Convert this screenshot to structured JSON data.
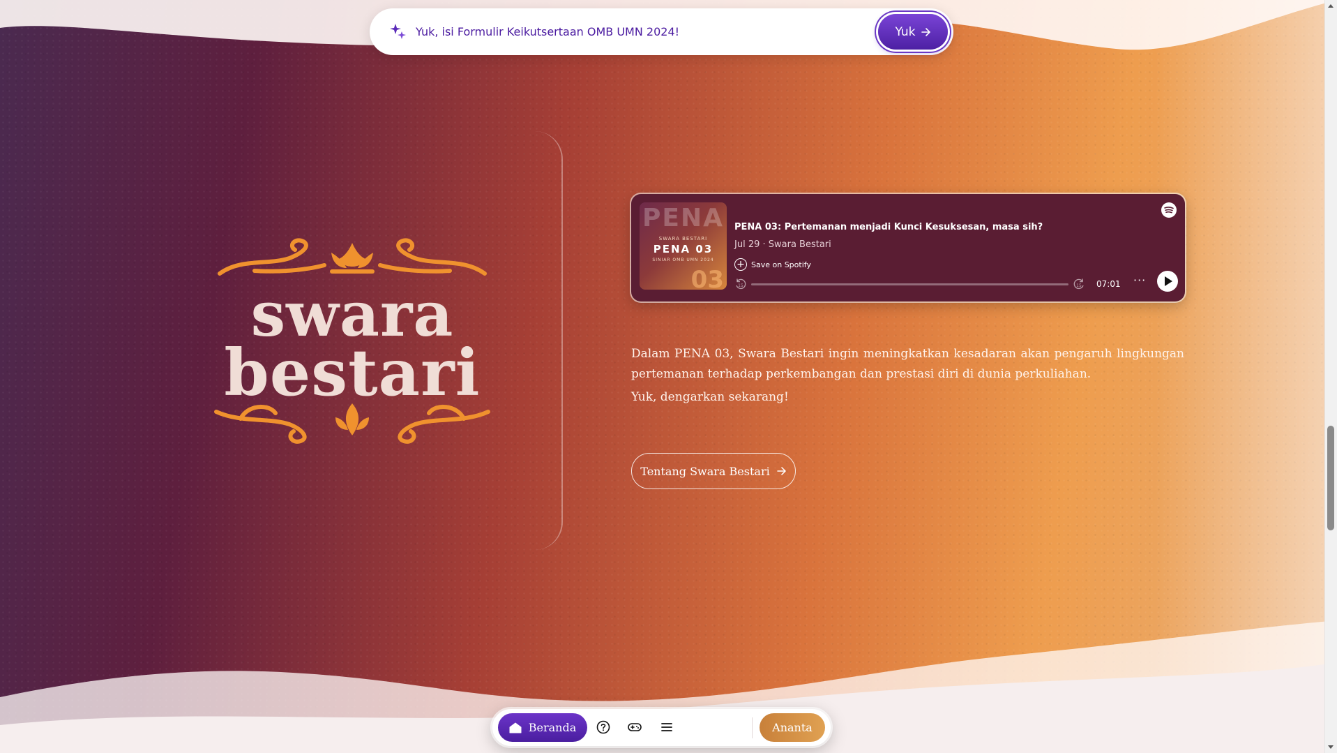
{
  "announcement": {
    "text": "Yuk, isi Formulir Keikutsertaan OMB UMN 2024!",
    "button_label": "Yuk",
    "icon": "sparkle-icon"
  },
  "logo": {
    "line1": "swara",
    "line2": "bestari"
  },
  "player": {
    "cover": {
      "watermark": "PENA",
      "brand": "SWARA BESTARI",
      "title": "PENA 03",
      "subtitle": "SINIAR OMB UMN 2024",
      "number": "03"
    },
    "episode_title": "PENA 03: Pertemanan menjadi Kunci Kesuksesan, masa sih?",
    "meta": "Jul 29 · Swara Bestari",
    "save_label": "Save on Spotify",
    "duration": "07:01",
    "more": "···",
    "progress": 0
  },
  "description": "Dalam PENA 03, Swara Bestari ingin meningkatkan kesadaran akan pengaruh lingkungan pertemanan terhadap perkembangan dan prestasi diri di dunia perkuliahan.",
  "call_to_action": "Yuk, dengarkan sekarang!",
  "about_button": "Tentang Swara Bestari",
  "nav": {
    "home_label": "Beranda",
    "profile_label": "Ananta",
    "icons": [
      "home-icon",
      "help-icon",
      "gamepad-icon",
      "menu-icon"
    ]
  },
  "colors": {
    "accent_purple": "#4d20a4",
    "ornament_orange": "#f0922e",
    "spotify_card": "#5a1d33",
    "profile_gold": "#d9963f"
  }
}
